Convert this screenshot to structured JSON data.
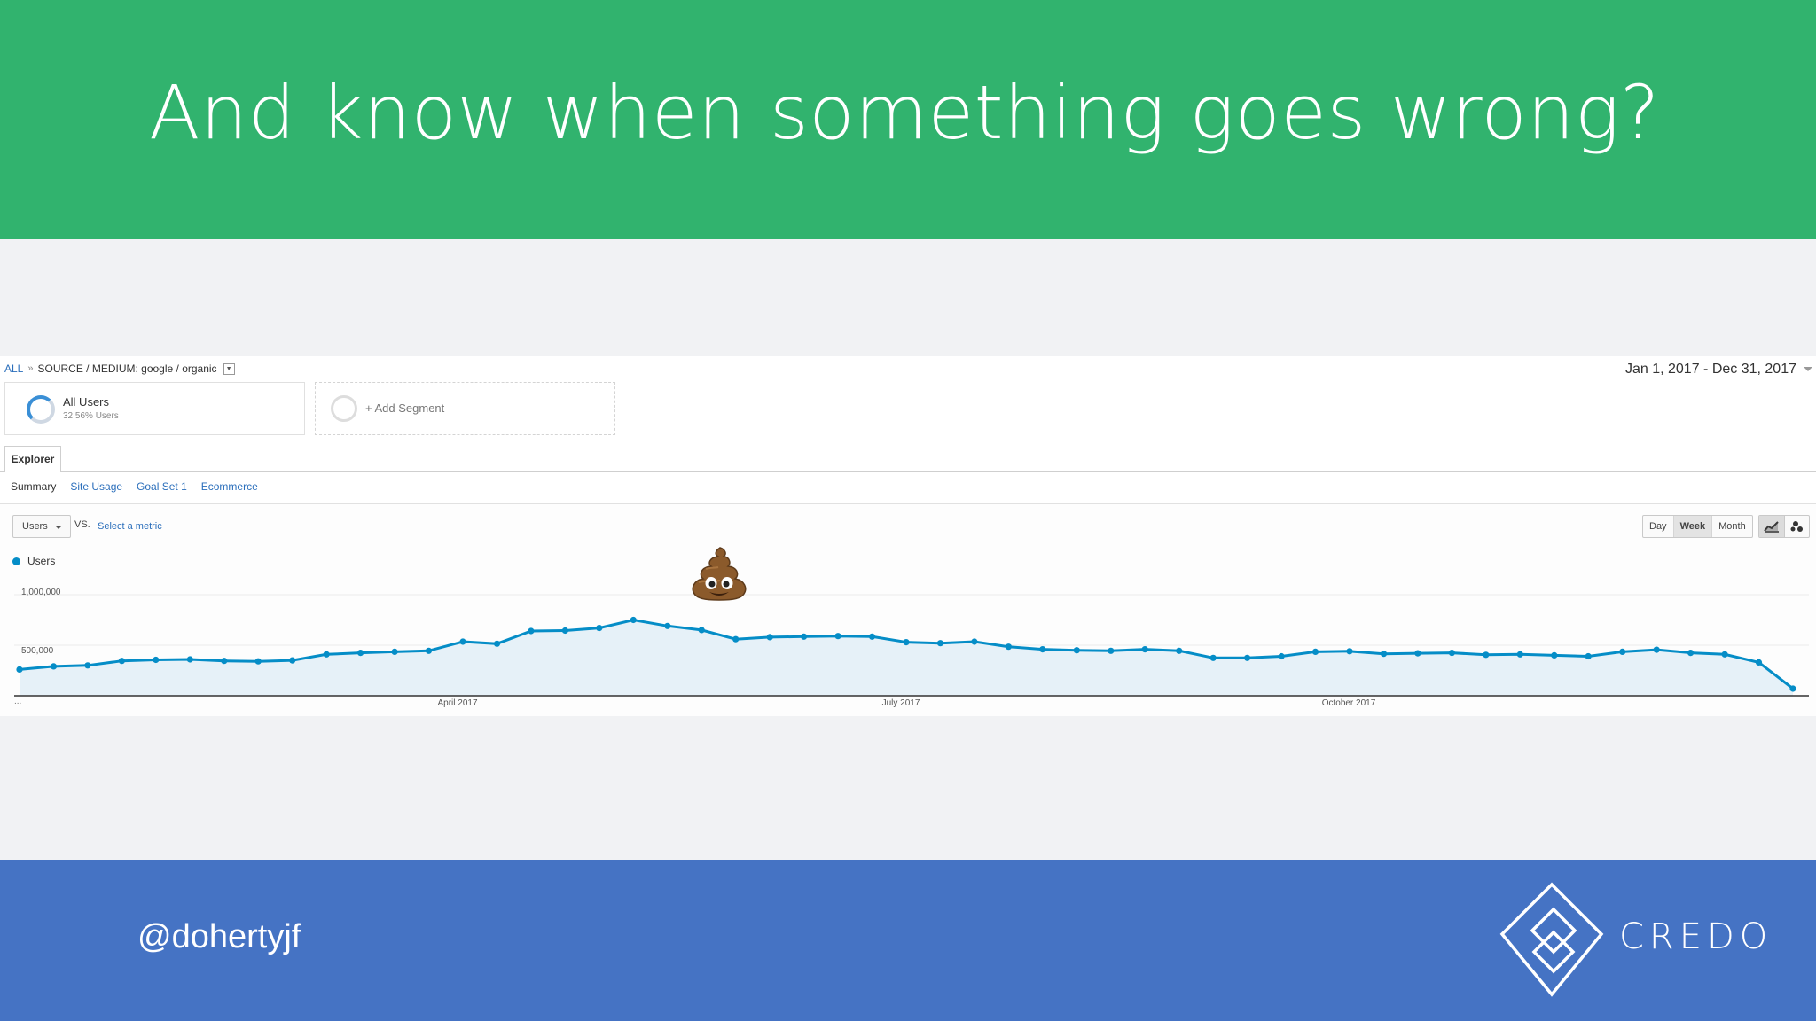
{
  "slide": {
    "title": "And know when something goes wrong?",
    "twitter_handle": "@dohertyjf",
    "brand_name": "CREDO",
    "colors": {
      "header": "#31b36e",
      "footer": "#4573c4",
      "series": "#058dc7"
    }
  },
  "analytics": {
    "breadcrumb": {
      "all": "ALL",
      "separator": "»",
      "source_label": "SOURCE / MEDIUM: google / organic"
    },
    "date_range": "Jan 1, 2017 - Dec 31, 2017",
    "segments": {
      "all_users": {
        "name": "All Users",
        "percent": "32.56% Users"
      },
      "add_label": "+ Add Segment"
    },
    "tab": "Explorer",
    "subtabs": [
      "Summary",
      "Site Usage",
      "Goal Set 1",
      "Ecommerce"
    ],
    "metric": {
      "selected": "Users",
      "vs": "VS.",
      "select_link": "Select a metric"
    },
    "period_buttons": [
      "Day",
      "Week",
      "Month"
    ],
    "period_selected": "Week",
    "legend": "Users",
    "y_ticks": [
      "1,000,000",
      "500,000"
    ],
    "x_ticks": [
      "...",
      "April 2017",
      "July 2017",
      "October 2017"
    ],
    "icons": {
      "annotation": "poop-emoji-icon",
      "line_view": "line-chart-icon",
      "motion_view": "motion-chart-icon",
      "logo": "credo-diamond-logo"
    }
  },
  "chart_data": {
    "type": "area",
    "series": [
      {
        "name": "Users",
        "values": [
          260000,
          290000,
          300000,
          345000,
          355000,
          360000,
          345000,
          340000,
          350000,
          410000,
          425000,
          435000,
          445000,
          535000,
          515000,
          640000,
          645000,
          670000,
          750000,
          690000,
          650000,
          560000,
          580000,
          585000,
          590000,
          585000,
          530000,
          520000,
          535000,
          485000,
          460000,
          450000,
          445000,
          460000,
          445000,
          375000,
          375000,
          390000,
          435000,
          440000,
          415000,
          420000,
          425000,
          405000,
          410000,
          400000,
          390000,
          435000,
          455000,
          425000,
          410000,
          330000,
          70000
        ]
      }
    ],
    "x_start": "Jan 1, 2017",
    "x_end": "Dec 31, 2017",
    "xlabel": "",
    "ylabel": "",
    "y_ticks": [
      500000,
      1000000
    ],
    "ylim": [
      0,
      1000000
    ],
    "granularity": "Week",
    "grid": true,
    "legend": "top-left"
  }
}
